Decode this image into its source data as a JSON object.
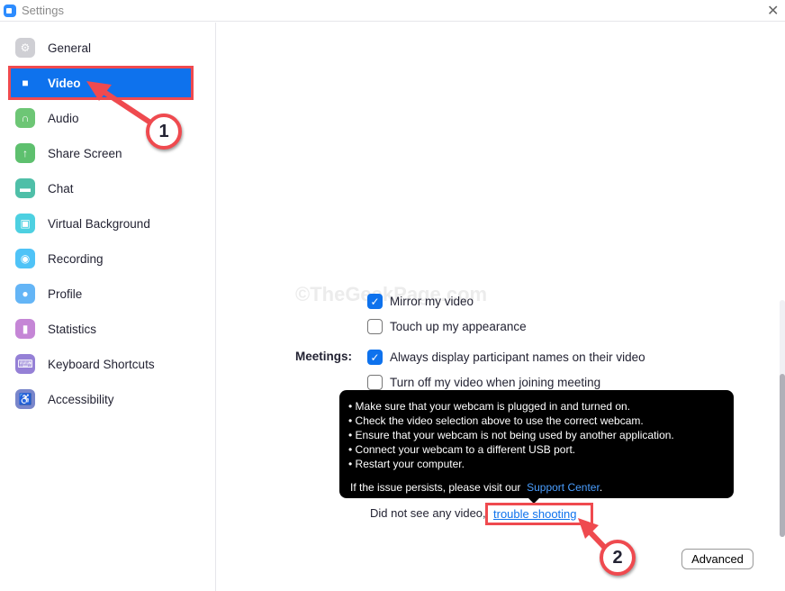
{
  "window": {
    "title": "Settings",
    "close_icon": "close-icon"
  },
  "sidebar": {
    "items": [
      {
        "label": "General",
        "icon": "gear-icon",
        "color": "#cfcfd4"
      },
      {
        "label": "Video",
        "icon": "video-camera-icon",
        "color": "#0e72ed",
        "active": true
      },
      {
        "label": "Audio",
        "icon": "headphones-icon",
        "color": "#6dc675"
      },
      {
        "label": "Share Screen",
        "icon": "share-screen-icon",
        "color": "#5ec06e"
      },
      {
        "label": "Chat",
        "icon": "chat-bubble-icon",
        "color": "#4fbfa8"
      },
      {
        "label": "Virtual Background",
        "icon": "virtual-background-icon",
        "color": "#4dd0e1"
      },
      {
        "label": "Recording",
        "icon": "record-icon",
        "color": "#4fc3f7"
      },
      {
        "label": "Profile",
        "icon": "person-icon",
        "color": "#64b5f6"
      },
      {
        "label": "Statistics",
        "icon": "bar-chart-icon",
        "color": "#c586d6"
      },
      {
        "label": "Keyboard Shortcuts",
        "icon": "keyboard-icon",
        "color": "#9580d6"
      },
      {
        "label": "Accessibility",
        "icon": "accessibility-icon",
        "color": "#7986cb"
      }
    ]
  },
  "main": {
    "watermark": "©TheGeekPage.com",
    "options": [
      {
        "label": "Mirror my video",
        "checked": true
      },
      {
        "label": "Touch up my appearance",
        "checked": false
      },
      {
        "label": "Always display participant names on their video",
        "checked": true
      },
      {
        "label": "Turn off my video when joining meeting",
        "checked": false
      }
    ],
    "meetings_label": "Meetings:",
    "tooltip": {
      "bullets": [
        "Make sure that your webcam is plugged in and turned on.",
        "Check the video selection above to use the correct webcam.",
        "Ensure that your webcam is not being used by another application.",
        "Connect your webcam to a different USB port.",
        "Restart your computer."
      ],
      "persist_text": "If the issue persists, please visit our",
      "support_link": "Support Center",
      "period": "."
    },
    "no_video_text": "Did not see any video,",
    "troubleshoot_link": "trouble shooting",
    "advanced_button": "Advanced"
  },
  "annotations": {
    "step1": "1",
    "step2": "2",
    "accent": "#ef4a4f"
  }
}
